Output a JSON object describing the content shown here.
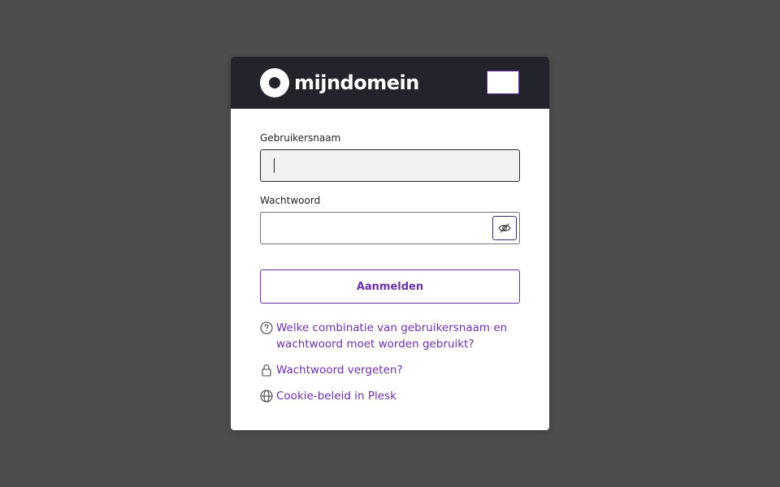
{
  "header": {
    "logo_text": "mijndomein"
  },
  "form": {
    "username_label": "Gebruikersnaam",
    "username_value": "",
    "password_label": "Wachtwoord",
    "password_value": "",
    "submit_label": "Aanmelden"
  },
  "links": [
    {
      "label": "Welke combinatie van gebruikersnaam en wachtwoord moet worden gebruikt?",
      "icon": "question-circle-icon"
    },
    {
      "label": "Wachtwoord vergeten?",
      "icon": "lock-icon"
    },
    {
      "label": "Cookie-beleid in Plesk",
      "icon": "globe-icon"
    }
  ],
  "colors": {
    "background": "#4d4d4d",
    "header": "#23232b",
    "accent": "#6b2fa8"
  }
}
